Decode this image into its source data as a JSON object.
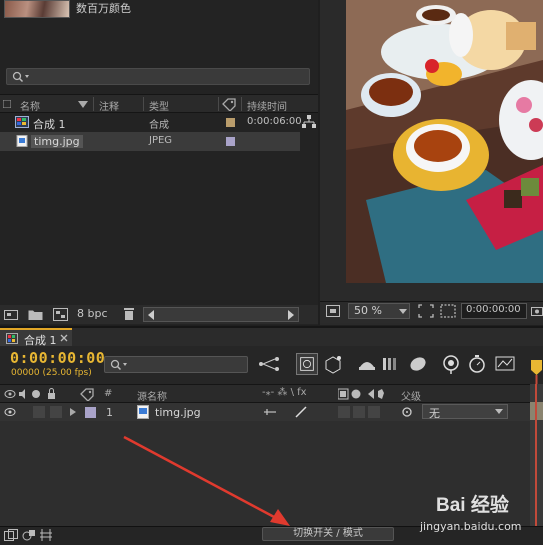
{
  "project": {
    "thumb_desc": "数百万颜色",
    "columns": {
      "name": "名称",
      "comment": "注释",
      "type": "类型",
      "duration": "持续时间"
    },
    "rows": [
      {
        "name": "合成 1",
        "type": "合成",
        "duration": "0:00:06:00",
        "label_color": "#b99c6b"
      },
      {
        "name": "timg.jpg",
        "type": "JPEG",
        "duration": "",
        "label_color": "#a9a3c9"
      }
    ],
    "bpc": "8 bpc"
  },
  "viewer": {
    "zoom": "50 %",
    "timecode": "0:00:00:00"
  },
  "timeline": {
    "tab_label": "合成 1",
    "timecode": "0:00:00:00",
    "frames": "00000 (25.00 fps)",
    "columns": {
      "num": "#",
      "source": "源名称",
      "switches": "-⁎- ⁂ \\ fx",
      "parent": "父级"
    },
    "layer": {
      "index": "1",
      "name": "timg.jpg",
      "parent": "无",
      "label_color": "#a9a3c9"
    },
    "toggle_label": "切换开关 / 模式"
  },
  "watermark": {
    "brand": "Bai 经验",
    "url": "jingyan.baidu.com"
  },
  "colors": {
    "accent": "#e8b733",
    "arrow": "#e03a2e",
    "playhead": "#c24a3a"
  }
}
